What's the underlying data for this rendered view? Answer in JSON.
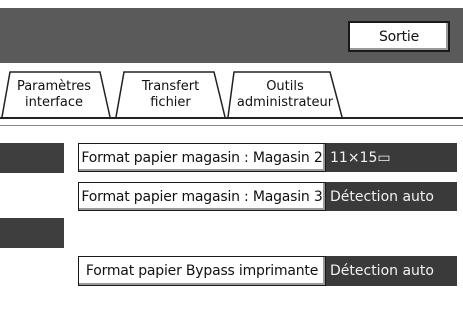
{
  "header": {
    "exit_label": "Sortie"
  },
  "tabs": [
    {
      "line1": "Paramètres",
      "line2": "interface"
    },
    {
      "line1": "Transfert",
      "line2": "fichier"
    },
    {
      "line1": "Outils",
      "line2": "administrateur"
    }
  ],
  "settings": [
    {
      "label": "Format papier magasin : Magasin 2",
      "value": "11×15▭"
    },
    {
      "label": "Format papier magasin : Magasin 3",
      "value": "Détection auto"
    },
    {
      "label": "Format papier Bypass imprimante",
      "value": "Détection auto"
    }
  ]
}
